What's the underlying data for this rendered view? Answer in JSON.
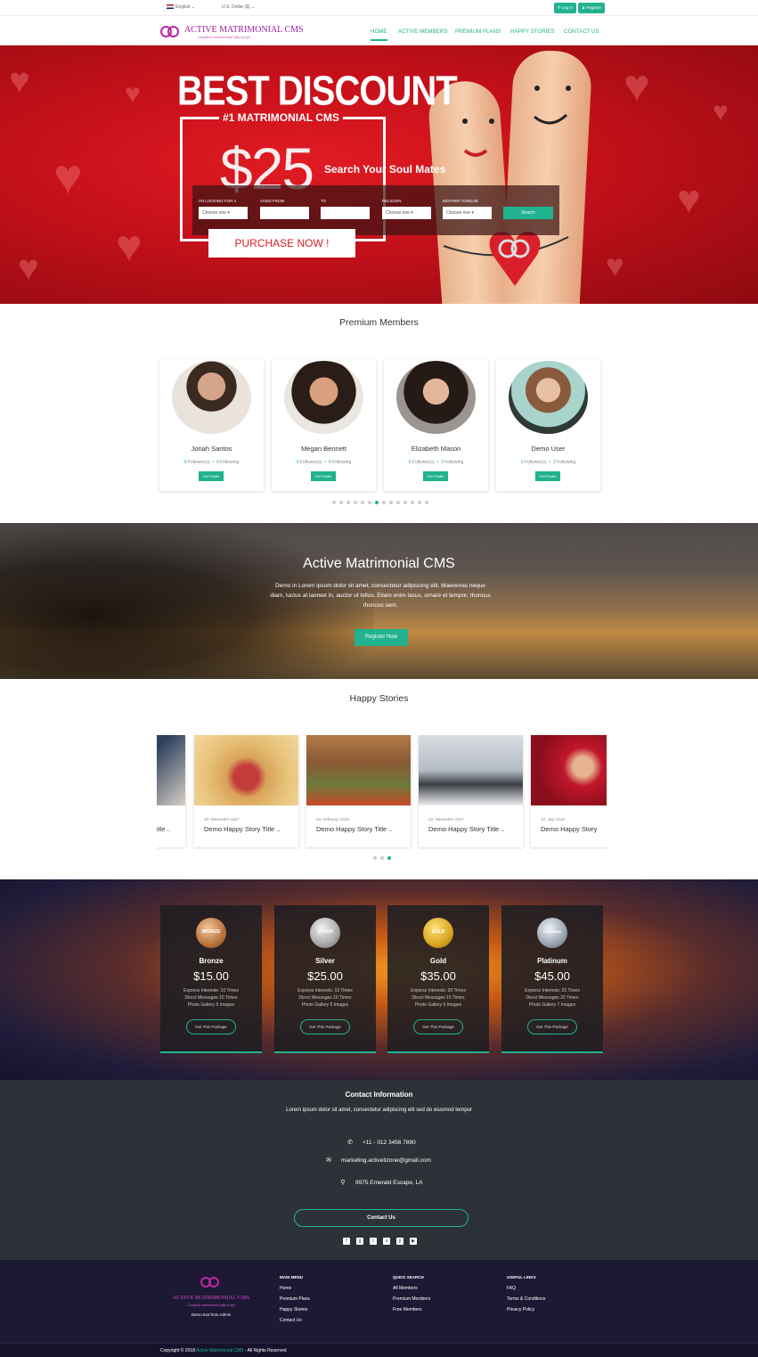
{
  "topbar": {
    "language": "English",
    "currency": "U.S. Dollar ($)",
    "login_label": "Log In",
    "register_label": "Register"
  },
  "brand": {
    "name": "ACTIVE MATRIMONIAL CMS",
    "tagline": "complete matrimonial php script",
    "colors": {
      "accent": "#21b28f",
      "brand": "#9b1da0",
      "hero_red": "#d4151e"
    }
  },
  "nav": {
    "items": [
      "HOME",
      "ACTIVE MEMBERS",
      "PREMIUM PLANS",
      "HAPPY STORIES",
      "CONTACT US"
    ]
  },
  "hero": {
    "headline": "BEST DISCOUNT",
    "sub": "#1 MATRIMONIAL CMS",
    "price": "$25",
    "cta": "PURCHASE NOW !",
    "search_title": "Search Your Soul Mates",
    "search": {
      "looking_for_label": "I'M LOOKING FOR A",
      "aged_from_label": "AGED FROM",
      "to_label": "TO",
      "religion_label": "RELIGION",
      "mother_tongue_label": "MOTHER TONGUE",
      "choose_one": "Choose one",
      "button": "Search"
    }
  },
  "premium_members": {
    "title": "Premium Members",
    "members": [
      {
        "name": "Jonah Santos",
        "followers": "0",
        "following": "0",
        "followers_label": "Follower(s)",
        "following_label": "Following",
        "button": "Full Profile"
      },
      {
        "name": "Megan Bennett",
        "followers": "0",
        "following": "0",
        "followers_label": "Follower(s)",
        "following_label": "Following",
        "button": "Full Profile"
      },
      {
        "name": "Elizabeth Mason",
        "followers": "0",
        "following": "3",
        "followers_label": "Follower(s)",
        "following_label": "Following",
        "button": "Full Profile"
      },
      {
        "name": "Demo User",
        "followers": "0",
        "following": "2",
        "followers_label": "Follower(s)",
        "following_label": "Following",
        "button": "Full Profile"
      }
    ]
  },
  "promo": {
    "title": "Active Matrimonial CMS",
    "text": "Demo in Lorem ipsum dolor sit amet, consectetur adipiscing elit. Maecenas neque diam, luctus at laoreet in, auctor ut tellus. Etiam enim lacus, ornare et tempor, rhoncus rhoncus sem.",
    "button": "Register Now"
  },
  "happy_stories": {
    "title": "Happy Stories",
    "stories": [
      {
        "date": "",
        "title": "itle .."
      },
      {
        "date": "30, December 2017",
        "title": "Demo Happy Story Title .."
      },
      {
        "date": "04, February 2018",
        "title": "Demo Happy Story Title .."
      },
      {
        "date": "22, November 2017",
        "title": "Demo Happy Story Title .."
      },
      {
        "date": "10, July 2018",
        "title": "Demo Happy Story"
      }
    ]
  },
  "plans": [
    {
      "badge": "BRONZE",
      "name": "Bronze",
      "price": "$15.00",
      "features": [
        "Express Interests: 10 Times",
        "Direct Messages 10 Times",
        "Photo Gallery 5 Images"
      ],
      "button": "Get This Package"
    },
    {
      "badge": "SILVER",
      "name": "Silver",
      "price": "$25.00",
      "features": [
        "Express Interests: 15 Times",
        "Direct Messages 10 Times",
        "Photo Gallery 5 Images"
      ],
      "button": "Get This Package"
    },
    {
      "badge": "GOLD",
      "name": "Gold",
      "price": "$35.00",
      "features": [
        "Express Interests: 20 Times",
        "Direct Messages 15 Times",
        "Photo Gallery 5 Images"
      ],
      "button": "Get This Package"
    },
    {
      "badge": "PLATINUM",
      "name": "Platinum",
      "price": "$45.00",
      "features": [
        "Express Interests: 25 Times",
        "Direct Messages 20 Times",
        "Photo Gallery 7 Images"
      ],
      "button": "Get This Package"
    }
  ],
  "contact": {
    "title": "Contact Information",
    "subtitle": "Lorem ipsum dolor sit amet, consectetur adipiscing elit sed do eiusmod tempor",
    "phone": "+11 - 012 3456 7890",
    "email": "marketing.activeitzone@gmail.com",
    "address": "9975 Emerald Escape, LA",
    "button": "Contact Us"
  },
  "footer": {
    "logo_name": "ACTIVE MATRIMONIAL CMS",
    "logo_tagline": "Complete matrimonial php script",
    "demo_text": "Demo text from Admin",
    "columns": [
      {
        "title": "MAIN MENU",
        "links": [
          "Home",
          "Premium Plans",
          "Happy Stories",
          "Contact Us"
        ]
      },
      {
        "title": "QUICK SEARCH",
        "links": [
          "All Members",
          "Premium Members",
          "Free Members"
        ]
      },
      {
        "title": "USEFUL LINKS",
        "links": [
          "FAQ",
          "Terms & Conditions",
          "Privacy Policy"
        ]
      }
    ],
    "copyright_prefix": "Copyright © 2018",
    "copyright_brand": "Active Matrimonial CMS",
    "copyright_suffix": "- All Rights Reserved"
  }
}
